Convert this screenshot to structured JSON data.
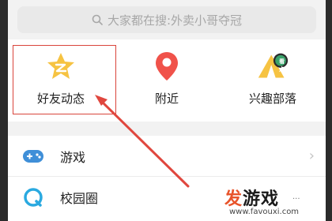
{
  "search": {
    "placeholder": "大家都在搜:外卖小哥夺冠"
  },
  "grid": {
    "items": [
      {
        "label": "好友动态",
        "icon": "star-icon",
        "color": "#f6c342"
      },
      {
        "label": "附近",
        "icon": "location-pin-icon",
        "color": "#f0524a"
      },
      {
        "label": "兴趣部落",
        "icon": "tent-icon",
        "color": "#f6c342",
        "badge": "看点"
      }
    ]
  },
  "list": {
    "rows": [
      {
        "label": "游戏",
        "icon": "gamepad-icon",
        "color": "#3f8fd8"
      },
      {
        "label": "校园圈",
        "icon": "campus-icon",
        "color": "#2aa9e0"
      }
    ]
  },
  "watermark": {
    "title_accent": "发",
    "title_rest": "游戏",
    "url": "www.favouxi.com",
    "dots": "..."
  },
  "colors": {
    "highlight": "#d9443b",
    "arrow": "#e0473e"
  }
}
